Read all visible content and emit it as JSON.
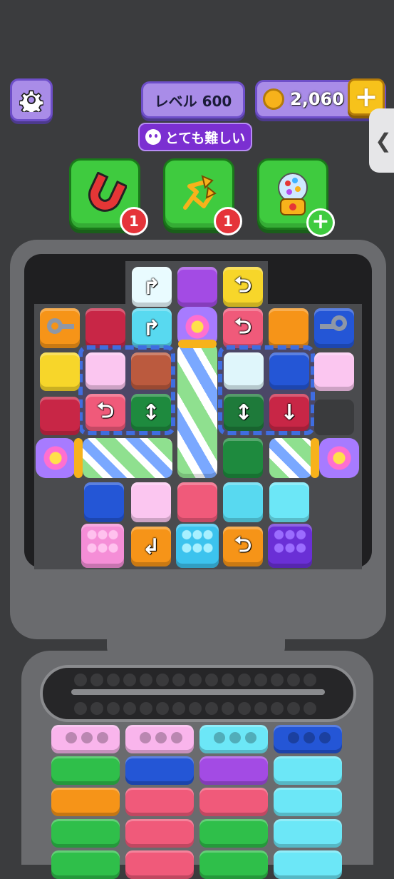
{
  "hud": {
    "level_label": "レベル 600",
    "coins": "2,060",
    "difficulty": "とても難しい",
    "plus": "+",
    "settings_icon": "gear-icon",
    "coin_icon": "coin-icon",
    "skull_icon": "skull-icon",
    "side_tab_icon": "chevron-left-icon",
    "side_tab_glyph": "❮"
  },
  "boosters": [
    {
      "name": "magnet-booster",
      "icon": "magnet-icon",
      "count": "1"
    },
    {
      "name": "shuffle-booster",
      "icon": "shuffle-icon",
      "count": "1"
    },
    {
      "name": "gumball-booster",
      "icon": "gumball-machine-icon",
      "count": "+"
    }
  ],
  "colors": {
    "background": "#3b3c3e",
    "board": "#4a4b4e",
    "accent_purple": "#a98ce8",
    "booster_green": "#3fcb3f",
    "badge_red": "#e5343a",
    "coin_gold": "#f7b21b"
  },
  "board": {
    "arrows": {
      "turn_right_up": "↱",
      "turn_left_down": "↲",
      "up_down": "↕",
      "down": "↓",
      "turn_curl": "⮌"
    }
  }
}
